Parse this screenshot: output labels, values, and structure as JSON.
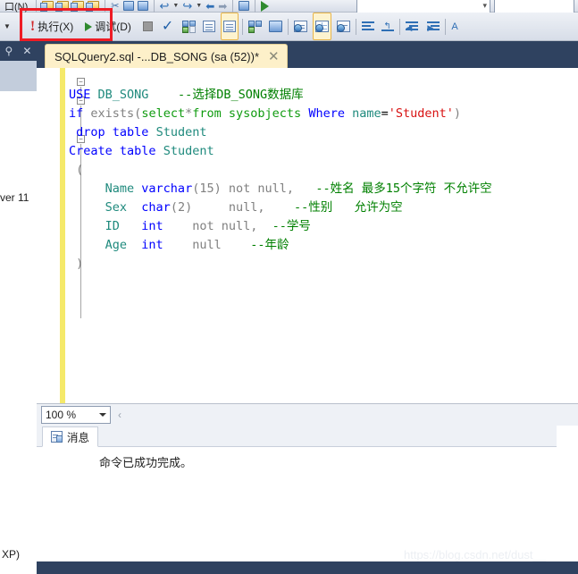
{
  "toolbar_top": {
    "items": [
      {
        "name": "menu-item-window-partial",
        "label": "口(N)",
        "icon": "menu-text"
      },
      {
        "name": "new-project-icon",
        "label": "",
        "icon": "folder-icon"
      },
      {
        "name": "open-project-icon",
        "label": "",
        "icon": "folder-icon"
      },
      {
        "name": "open-file-icon",
        "label": "",
        "icon": "folder-icon"
      },
      {
        "name": "save-all-icon",
        "label": "",
        "icon": "folder-icon"
      },
      {
        "name": "cut-icon",
        "label": "",
        "icon": "scissors-icon"
      },
      {
        "name": "copy-icon",
        "label": "",
        "icon": "copy-icon"
      },
      {
        "name": "paste-icon",
        "label": "",
        "icon": "paste-icon"
      },
      {
        "name": "undo-icon",
        "label": "",
        "icon": "undo-icon"
      },
      {
        "name": "redo-icon",
        "label": "",
        "icon": "redo-icon"
      },
      {
        "name": "navigate-back-icon",
        "label": "",
        "icon": "arrow-left-icon"
      },
      {
        "name": "navigate-forward-icon",
        "label": "",
        "icon": "arrow-right-icon"
      },
      {
        "name": "new-query-icon",
        "label": "",
        "icon": "new-query-icon"
      },
      {
        "name": "start-debug-icon",
        "label": "",
        "icon": "play-icon"
      }
    ]
  },
  "toolbar_main": {
    "database_combo_value": "",
    "execute_button": {
      "label": "执行(X)",
      "icon": "exclamation-icon",
      "highlighted": true
    },
    "debug_button": {
      "label": "调试(D)",
      "icon": "play-triangle-icon"
    },
    "items": [
      {
        "name": "stop-button",
        "icon": "stop-square-icon"
      },
      {
        "name": "parse-button",
        "icon": "checkmark-icon"
      },
      {
        "name": "display-estimated-execution-plan-button",
        "icon": "estimated-plan-icon"
      },
      {
        "name": "query-options-button",
        "icon": "query-options-icon"
      },
      {
        "name": "results-to-text-button",
        "icon": "results-to-text-icon"
      },
      {
        "name": "include-actual-execution-plan-button",
        "icon": "actual-plan-icon"
      },
      {
        "name": "include-client-statistics-button",
        "icon": "client-statistics-icon"
      },
      {
        "name": "results-to-file-button",
        "icon": "results-to-file-icon"
      },
      {
        "name": "results-to-grid-button",
        "icon": "results-to-grid-icon"
      },
      {
        "name": "results-to-text2-button",
        "icon": "results-to-text2-icon"
      },
      {
        "name": "comment-lines-button",
        "icon": "comment-lines-icon"
      },
      {
        "name": "uncomment-lines-button",
        "icon": "uncomment-lines-icon"
      },
      {
        "name": "decrease-indent-button",
        "icon": "decrease-indent-icon"
      },
      {
        "name": "increase-indent-button",
        "icon": "increase-indent-icon"
      }
    ]
  },
  "left_dock": {
    "pin_icon": "pin-icon",
    "close_icon": "close-icon",
    "partial_text": "ver 11",
    "bottom_text": "XP)"
  },
  "editor": {
    "tab": {
      "title": "SQLQuery2.sql -...DB_SONG (sa (52))*",
      "close_label": "✕"
    },
    "zoom": {
      "value": "100 %",
      "scroll_left_label": "‹"
    },
    "code_lines": [
      "USE DB_SONG    --选择DB_SONG数据库",
      "if exists(select*from sysobjects Where name='Student')",
      " drop table Student",
      "Create table Student",
      " (",
      "     Name varchar(15) not null,   --姓名 最多15个字符 不允许空",
      "     Sex  char(2)     null,    --性别   允许为空",
      "     ID   int    not null,  --学号",
      "     Age  int    null    --年龄",
      " )"
    ]
  },
  "results": {
    "tab_label": "消息",
    "tab_icon": "message-icon",
    "message": "命令已成功完成。"
  },
  "watermark": "https://blog.csdn.net/dust__",
  "colors": {
    "accent_highlight": "#ee1c25",
    "tab_background": "#fdf0c9",
    "window_chrome": "#2f4260",
    "toolbar_gradient_top": "#eef1f6",
    "toolbar_gradient_bottom": "#d7dde8",
    "code_keyword": "#0000ff",
    "code_comment": "#008000",
    "code_string": "#d81111",
    "code_identifier": "#1f8a7d",
    "code_function": "#0f9b0f",
    "indicator_bar": "#f5e96a"
  }
}
